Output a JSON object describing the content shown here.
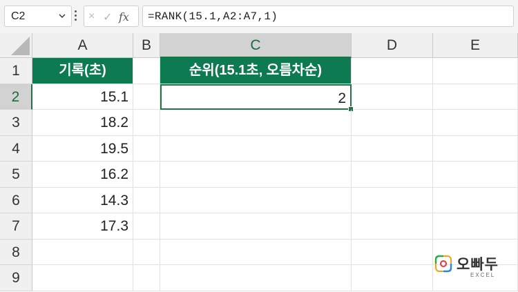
{
  "formula_bar": {
    "name_box": "C2",
    "cancel_icon": "×",
    "enter_icon": "✓",
    "function_icon": "fx",
    "formula": "=RANK(15.1,A2:A7,1)"
  },
  "columns": [
    "A",
    "B",
    "C",
    "D",
    "E"
  ],
  "rows": [
    "1",
    "2",
    "3",
    "4",
    "5",
    "6",
    "7",
    "8",
    "9"
  ],
  "cells": {
    "A1": "기록(초)",
    "A2": "15.1",
    "A3": "18.2",
    "A4": "19.5",
    "A5": "16.2",
    "A6": "14.3",
    "A7": "17.3",
    "C1": "순위(15.1초, 오름차순)",
    "C2": "2"
  },
  "active_cell": "C2",
  "colors": {
    "header_fill": "#0e7a52",
    "selection": "#217346"
  },
  "watermark": {
    "brand": "오빠두",
    "sub": "EXCEL"
  }
}
